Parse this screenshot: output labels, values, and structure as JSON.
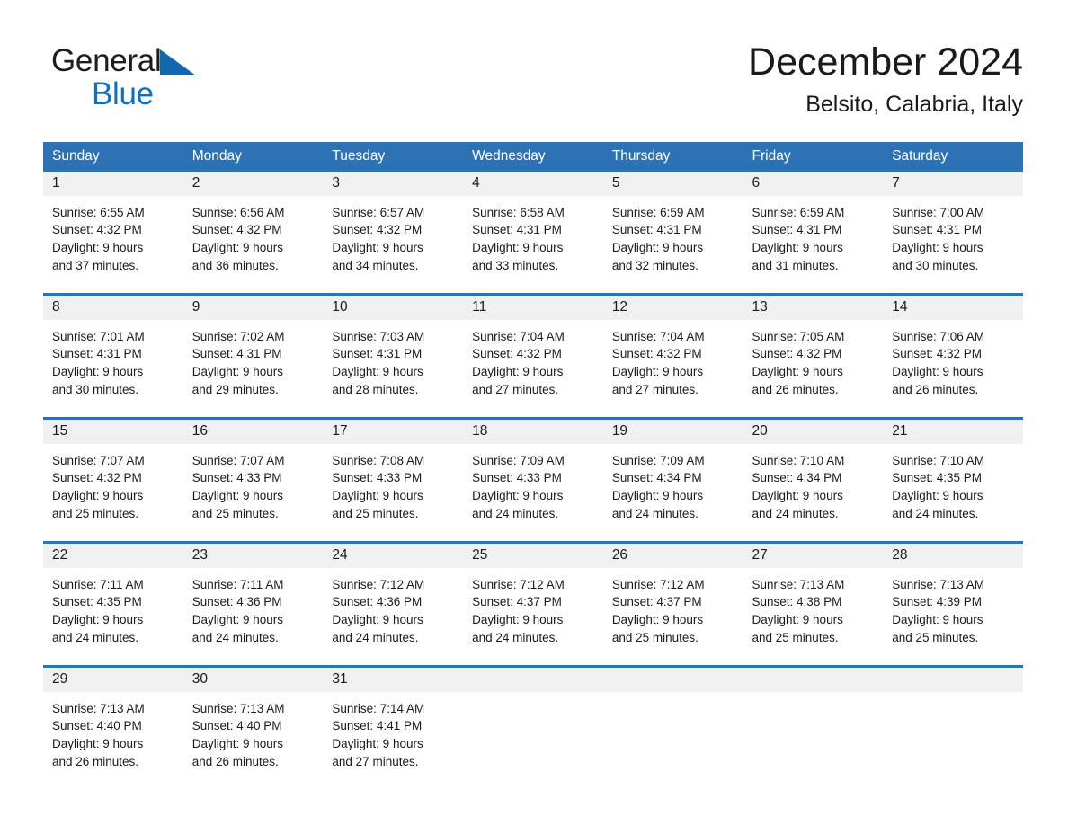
{
  "brand": {
    "word1": "General",
    "word2": "Blue",
    "triangle_color": "#1268ac",
    "word2_color": "#0f6fc5"
  },
  "header": {
    "month_title": "December 2024",
    "location": "Belsito, Calabria, Italy"
  },
  "theme": {
    "header_blue": "#2d72b5",
    "date_band_gray": "#f0f0f0",
    "text": "#1a1a1a"
  },
  "weekday_headers": [
    "Sunday",
    "Monday",
    "Tuesday",
    "Wednesday",
    "Thursday",
    "Friday",
    "Saturday"
  ],
  "weeks": [
    [
      {
        "date": "1",
        "sunrise": "Sunrise: 6:55 AM",
        "sunset": "Sunset: 4:32 PM",
        "daylight_line1": "Daylight: 9 hours",
        "daylight_line2": "and 37 minutes."
      },
      {
        "date": "2",
        "sunrise": "Sunrise: 6:56 AM",
        "sunset": "Sunset: 4:32 PM",
        "daylight_line1": "Daylight: 9 hours",
        "daylight_line2": "and 36 minutes."
      },
      {
        "date": "3",
        "sunrise": "Sunrise: 6:57 AM",
        "sunset": "Sunset: 4:32 PM",
        "daylight_line1": "Daylight: 9 hours",
        "daylight_line2": "and 34 minutes."
      },
      {
        "date": "4",
        "sunrise": "Sunrise: 6:58 AM",
        "sunset": "Sunset: 4:31 PM",
        "daylight_line1": "Daylight: 9 hours",
        "daylight_line2": "and 33 minutes."
      },
      {
        "date": "5",
        "sunrise": "Sunrise: 6:59 AM",
        "sunset": "Sunset: 4:31 PM",
        "daylight_line1": "Daylight: 9 hours",
        "daylight_line2": "and 32 minutes."
      },
      {
        "date": "6",
        "sunrise": "Sunrise: 6:59 AM",
        "sunset": "Sunset: 4:31 PM",
        "daylight_line1": "Daylight: 9 hours",
        "daylight_line2": "and 31 minutes."
      },
      {
        "date": "7",
        "sunrise": "Sunrise: 7:00 AM",
        "sunset": "Sunset: 4:31 PM",
        "daylight_line1": "Daylight: 9 hours",
        "daylight_line2": "and 30 minutes."
      }
    ],
    [
      {
        "date": "8",
        "sunrise": "Sunrise: 7:01 AM",
        "sunset": "Sunset: 4:31 PM",
        "daylight_line1": "Daylight: 9 hours",
        "daylight_line2": "and 30 minutes."
      },
      {
        "date": "9",
        "sunrise": "Sunrise: 7:02 AM",
        "sunset": "Sunset: 4:31 PM",
        "daylight_line1": "Daylight: 9 hours",
        "daylight_line2": "and 29 minutes."
      },
      {
        "date": "10",
        "sunrise": "Sunrise: 7:03 AM",
        "sunset": "Sunset: 4:31 PM",
        "daylight_line1": "Daylight: 9 hours",
        "daylight_line2": "and 28 minutes."
      },
      {
        "date": "11",
        "sunrise": "Sunrise: 7:04 AM",
        "sunset": "Sunset: 4:32 PM",
        "daylight_line1": "Daylight: 9 hours",
        "daylight_line2": "and 27 minutes."
      },
      {
        "date": "12",
        "sunrise": "Sunrise: 7:04 AM",
        "sunset": "Sunset: 4:32 PM",
        "daylight_line1": "Daylight: 9 hours",
        "daylight_line2": "and 27 minutes."
      },
      {
        "date": "13",
        "sunrise": "Sunrise: 7:05 AM",
        "sunset": "Sunset: 4:32 PM",
        "daylight_line1": "Daylight: 9 hours",
        "daylight_line2": "and 26 minutes."
      },
      {
        "date": "14",
        "sunrise": "Sunrise: 7:06 AM",
        "sunset": "Sunset: 4:32 PM",
        "daylight_line1": "Daylight: 9 hours",
        "daylight_line2": "and 26 minutes."
      }
    ],
    [
      {
        "date": "15",
        "sunrise": "Sunrise: 7:07 AM",
        "sunset": "Sunset: 4:32 PM",
        "daylight_line1": "Daylight: 9 hours",
        "daylight_line2": "and 25 minutes."
      },
      {
        "date": "16",
        "sunrise": "Sunrise: 7:07 AM",
        "sunset": "Sunset: 4:33 PM",
        "daylight_line1": "Daylight: 9 hours",
        "daylight_line2": "and 25 minutes."
      },
      {
        "date": "17",
        "sunrise": "Sunrise: 7:08 AM",
        "sunset": "Sunset: 4:33 PM",
        "daylight_line1": "Daylight: 9 hours",
        "daylight_line2": "and 25 minutes."
      },
      {
        "date": "18",
        "sunrise": "Sunrise: 7:09 AM",
        "sunset": "Sunset: 4:33 PM",
        "daylight_line1": "Daylight: 9 hours",
        "daylight_line2": "and 24 minutes."
      },
      {
        "date": "19",
        "sunrise": "Sunrise: 7:09 AM",
        "sunset": "Sunset: 4:34 PM",
        "daylight_line1": "Daylight: 9 hours",
        "daylight_line2": "and 24 minutes."
      },
      {
        "date": "20",
        "sunrise": "Sunrise: 7:10 AM",
        "sunset": "Sunset: 4:34 PM",
        "daylight_line1": "Daylight: 9 hours",
        "daylight_line2": "and 24 minutes."
      },
      {
        "date": "21",
        "sunrise": "Sunrise: 7:10 AM",
        "sunset": "Sunset: 4:35 PM",
        "daylight_line1": "Daylight: 9 hours",
        "daylight_line2": "and 24 minutes."
      }
    ],
    [
      {
        "date": "22",
        "sunrise": "Sunrise: 7:11 AM",
        "sunset": "Sunset: 4:35 PM",
        "daylight_line1": "Daylight: 9 hours",
        "daylight_line2": "and 24 minutes."
      },
      {
        "date": "23",
        "sunrise": "Sunrise: 7:11 AM",
        "sunset": "Sunset: 4:36 PM",
        "daylight_line1": "Daylight: 9 hours",
        "daylight_line2": "and 24 minutes."
      },
      {
        "date": "24",
        "sunrise": "Sunrise: 7:12 AM",
        "sunset": "Sunset: 4:36 PM",
        "daylight_line1": "Daylight: 9 hours",
        "daylight_line2": "and 24 minutes."
      },
      {
        "date": "25",
        "sunrise": "Sunrise: 7:12 AM",
        "sunset": "Sunset: 4:37 PM",
        "daylight_line1": "Daylight: 9 hours",
        "daylight_line2": "and 24 minutes."
      },
      {
        "date": "26",
        "sunrise": "Sunrise: 7:12 AM",
        "sunset": "Sunset: 4:37 PM",
        "daylight_line1": "Daylight: 9 hours",
        "daylight_line2": "and 25 minutes."
      },
      {
        "date": "27",
        "sunrise": "Sunrise: 7:13 AM",
        "sunset": "Sunset: 4:38 PM",
        "daylight_line1": "Daylight: 9 hours",
        "daylight_line2": "and 25 minutes."
      },
      {
        "date": "28",
        "sunrise": "Sunrise: 7:13 AM",
        "sunset": "Sunset: 4:39 PM",
        "daylight_line1": "Daylight: 9 hours",
        "daylight_line2": "and 25 minutes."
      }
    ],
    [
      {
        "date": "29",
        "sunrise": "Sunrise: 7:13 AM",
        "sunset": "Sunset: 4:40 PM",
        "daylight_line1": "Daylight: 9 hours",
        "daylight_line2": "and 26 minutes."
      },
      {
        "date": "30",
        "sunrise": "Sunrise: 7:13 AM",
        "sunset": "Sunset: 4:40 PM",
        "daylight_line1": "Daylight: 9 hours",
        "daylight_line2": "and 26 minutes."
      },
      {
        "date": "31",
        "sunrise": "Sunrise: 7:14 AM",
        "sunset": "Sunset: 4:41 PM",
        "daylight_line1": "Daylight: 9 hours",
        "daylight_line2": "and 27 minutes."
      },
      {
        "date": "",
        "sunrise": "",
        "sunset": "",
        "daylight_line1": "",
        "daylight_line2": ""
      },
      {
        "date": "",
        "sunrise": "",
        "sunset": "",
        "daylight_line1": "",
        "daylight_line2": ""
      },
      {
        "date": "",
        "sunrise": "",
        "sunset": "",
        "daylight_line1": "",
        "daylight_line2": ""
      },
      {
        "date": "",
        "sunrise": "",
        "sunset": "",
        "daylight_line1": "",
        "daylight_line2": ""
      }
    ]
  ]
}
